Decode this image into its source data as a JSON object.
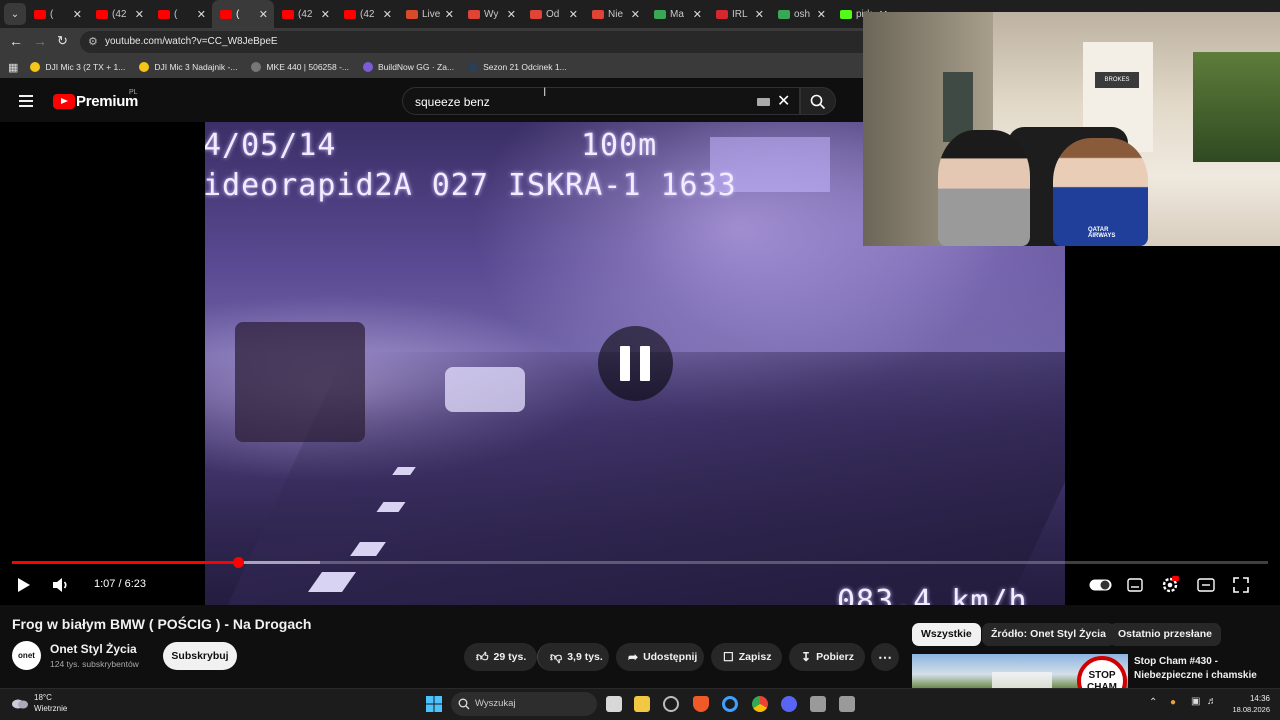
{
  "browser": {
    "tabs": [
      {
        "title": "(",
        "fav_color": "#ff0000"
      },
      {
        "title": "(42",
        "fav_color": "#ff0000"
      },
      {
        "title": "(",
        "fav_color": "#ff0000"
      },
      {
        "title": "(",
        "fav_color": "#ff0000",
        "active": true
      },
      {
        "title": "(42",
        "fav_color": "#ff0000"
      },
      {
        "title": "(42",
        "fav_color": "#ff0000"
      },
      {
        "title": "Live",
        "fav_color": "#d94a2a"
      },
      {
        "title": "Wy",
        "fav_color": "#e04436"
      },
      {
        "title": "Od",
        "fav_color": "#e04436"
      },
      {
        "title": "Nie",
        "fav_color": "#e04436"
      },
      {
        "title": "Ma",
        "fav_color": "#3aa757"
      },
      {
        "title": "IRL",
        "fav_color": "#d6262e"
      },
      {
        "title": "osh",
        "fav_color": "#3aa757"
      },
      {
        "title": "pirk",
        "fav_color": "#53fc18"
      }
    ],
    "url": "youtube.com/watch?v=CC_W8JeBpeE",
    "bookmarks": [
      {
        "label": "DJI Mic 3 (2 TX + 1...",
        "color": "#f5c518"
      },
      {
        "label": "DJI Mic 3 Nadajnik -...",
        "color": "#f5c518"
      },
      {
        "label": "MKE 440 | 506258 -...",
        "color": "#777777"
      },
      {
        "label": "BuildNow GG · Za...",
        "color": "#7b5cd6"
      },
      {
        "label": "Sezon 21 Odcinek 1...",
        "color": "#2b3f55"
      }
    ]
  },
  "youtube": {
    "brand": "Premium",
    "country": "PL",
    "search_value": "squeeze benz",
    "colors": {
      "accent": "#ff0000",
      "bg": "#0f0f0f"
    }
  },
  "video": {
    "overlay_date": "4/05/14",
    "overlay_distance": "100m",
    "overlay_device": "ideorapid2A 027 ISKRA-1 1633",
    "overlay_speed": "083.4 km/h",
    "played_fraction": 0.18,
    "buffered_fraction": 0.245,
    "time_current": "1:07",
    "time_total": "6:23",
    "time_display": "1:07 / 6:23"
  },
  "meta": {
    "title": "Frog w białym BMW ( POŚCIG ) - Na Drogach",
    "channel": "Onet Styl Życia",
    "channel_avatar": "onet",
    "subscribers": "124 tys. subskrybentów",
    "subscribe_label": "Subskrybuj",
    "likes": "29 tys.",
    "dislikes": "3,9 tys.",
    "share_label": "Udostępnij",
    "save_label": "Zapisz",
    "download_label": "Pobierz"
  },
  "sidebar": {
    "chips": [
      "Wszystkie",
      "Źródło: Onet Styl Życia",
      "Ostatnio przesłane"
    ],
    "rec_title": "Stop Cham #430 - Niebezpieczne i chamskie",
    "rec_sign": "STOP CHAM"
  },
  "webcam": {
    "wall_sign": "BROKES",
    "jersey_text": "QATAR AIRWAYS"
  },
  "taskbar": {
    "temperature": "18°C",
    "weather": "Wietrznie",
    "search_placeholder": "Wyszukaj",
    "time": "14:36",
    "date": "18.08.2026"
  }
}
